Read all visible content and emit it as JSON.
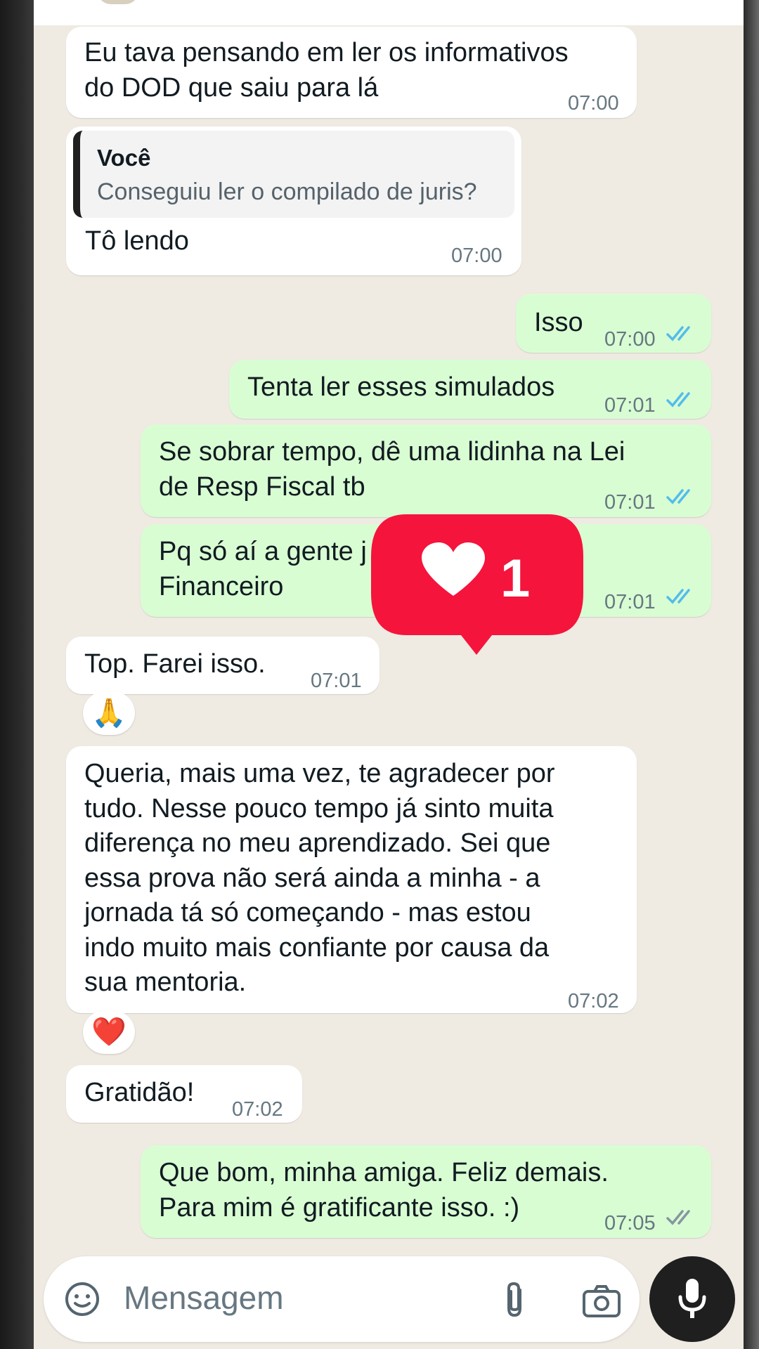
{
  "messages": [
    {
      "type": "incoming",
      "text_lines": [
        "Eu tava pensando em ler os informativos",
        "do DOD que saiu para lá"
      ],
      "time": "07:00"
    },
    {
      "type": "incoming",
      "quote": {
        "author": "Você",
        "text": "Conseguiu ler o compilado de juris?"
      },
      "text": "Tô lendo",
      "time": "07:00"
    },
    {
      "type": "outgoing",
      "text": "Isso",
      "time": "07:00",
      "status": "read"
    },
    {
      "type": "outgoing",
      "text": "Tenta ler esses simulados",
      "time": "07:01",
      "status": "read"
    },
    {
      "type": "outgoing",
      "text_lines": [
        "Se sobrar tempo, dê uma lidinha na Lei",
        "de Resp Fiscal tb"
      ],
      "time": "07:01",
      "status": "read"
    },
    {
      "type": "outgoing",
      "text_lines": [
        "Pq só aí a gente j",
        "Financeiro"
      ],
      "time": "07:01",
      "status": "read"
    },
    {
      "type": "incoming",
      "text": "Top. Farei isso.",
      "time": "07:01",
      "reaction": "🙏"
    },
    {
      "type": "incoming",
      "text_lines": [
        "Queria, mais uma vez, te agradecer por",
        "tudo. Nesse pouco tempo já sinto muita",
        "diferença no meu aprendizado. Sei que",
        "essa prova não será ainda a minha - a",
        "jornada tá só começando - mas estou",
        "indo muito mais confiante por causa da",
        "sua mentoria."
      ],
      "time": "07:02",
      "reaction": "❤️"
    },
    {
      "type": "incoming",
      "text": "Gratidão!",
      "time": "07:02"
    },
    {
      "type": "outgoing",
      "text_lines": [
        "Que bom, minha amiga. Feliz demais.",
        "Para mim é gratificante isso. :)"
      ],
      "time": "07:05",
      "status": "delivered"
    }
  ],
  "like_notification": {
    "count": "1",
    "icon": "heart-icon",
    "color": "#f5143c"
  },
  "input": {
    "placeholder": "Mensagem",
    "emoji_icon": "sticker-icon",
    "attach_icon": "paperclip-icon",
    "camera_icon": "camera-icon",
    "mic_icon": "mic-icon"
  },
  "colors": {
    "incoming": "#ffffff",
    "outgoing": "#d9fdd3",
    "read_ticks": "#53bdeb",
    "delivered_ticks": "#8696a0",
    "background": "#efeae2"
  }
}
